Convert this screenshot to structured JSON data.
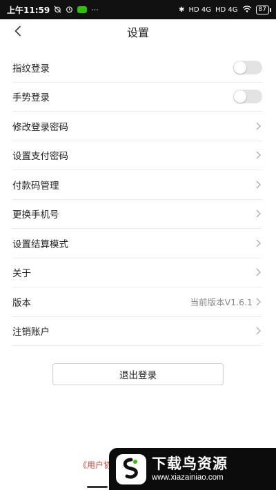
{
  "status_bar": {
    "time": "上午11:59",
    "alarm_icon": "alarm-off-icon",
    "clock_icon": "alarm-clock-icon",
    "more": "···",
    "bluetooth": "✱",
    "signal1": "HD 4G",
    "signal2": "HD 4G",
    "battery": "87"
  },
  "header": {
    "title": "设置"
  },
  "settings": {
    "items": [
      {
        "label": "指纹登录",
        "type": "toggle",
        "on": false
      },
      {
        "label": "手势登录",
        "type": "toggle",
        "on": false
      },
      {
        "label": "修改登录密码",
        "type": "link"
      },
      {
        "label": "设置支付密码",
        "type": "link"
      },
      {
        "label": "付款码管理",
        "type": "link"
      },
      {
        "label": "更换手机号",
        "type": "link"
      },
      {
        "label": "设置结算模式",
        "type": "link"
      },
      {
        "label": "关于",
        "type": "link"
      },
      {
        "label": "版本",
        "type": "link",
        "value": "当前版本V1.6.1"
      },
      {
        "label": "注销账户",
        "type": "link"
      }
    ]
  },
  "logout": {
    "label": "退出登录"
  },
  "footer": {
    "agreement_text": "《用户协"
  },
  "watermark": {
    "title": "下载鸟资源",
    "url": "www.xiazainiao.com"
  },
  "colors": {
    "accent_red": "#d0453a",
    "divider": "#ececec",
    "toggle_off": "#e3e3e3"
  }
}
